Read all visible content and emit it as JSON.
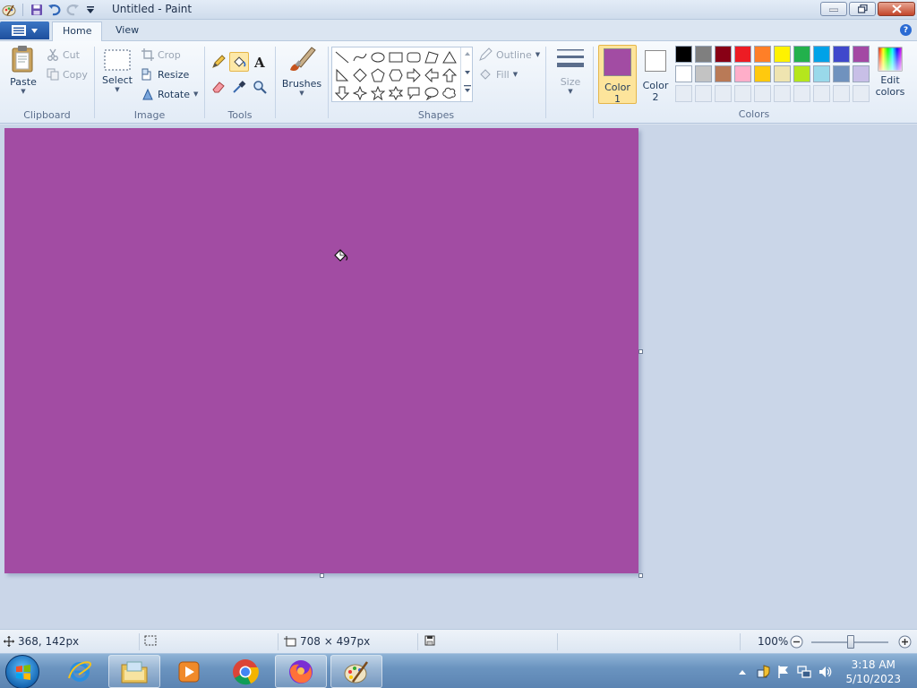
{
  "window": {
    "title": "Untitled - Paint"
  },
  "tabs": {
    "home": "Home",
    "view": "View"
  },
  "ribbon": {
    "clipboard": {
      "label": "Clipboard",
      "paste": "Paste",
      "cut": "Cut",
      "copy": "Copy"
    },
    "image": {
      "label": "Image",
      "select": "Select",
      "crop": "Crop",
      "resize": "Resize",
      "rotate": "Rotate"
    },
    "tools": {
      "label": "Tools",
      "selected": "fill"
    },
    "brushes": {
      "label": "Brushes"
    },
    "shapes": {
      "label": "Shapes",
      "outline": "Outline",
      "fill": "Fill"
    },
    "size": {
      "label": "Size"
    },
    "colors": {
      "label": "Colors",
      "color1_label_a": "Color",
      "color1_label_b": "1",
      "color2_label_a": "Color",
      "color2_label_b": "2",
      "color1": "#a24ca3",
      "color2": "#ffffff",
      "edit_a": "Edit",
      "edit_b": "colors",
      "palette_row1": [
        "#000000",
        "#7f7f7f",
        "#880015",
        "#ed1c24",
        "#ff7f27",
        "#fff200",
        "#22b14c",
        "#00a2e8",
        "#3f48cc",
        "#a349a4"
      ],
      "palette_row2": [
        "#ffffff",
        "#c3c3c3",
        "#b97a57",
        "#ffaec9",
        "#ffc90e",
        "#efe4b0",
        "#b5e61d",
        "#99d9ea",
        "#7092be",
        "#c8bfe7"
      ]
    }
  },
  "canvas": {
    "color": "#a24ca3"
  },
  "status": {
    "cursor_pos": "368, 142px",
    "canvas_size": "708 × 497px",
    "zoom": "100%"
  },
  "taskbar": {
    "time": "3:18 AM",
    "date": "5/10/2023",
    "apps": [
      "internet-explorer",
      "file-explorer",
      "media-player",
      "chrome",
      "firefox",
      "paint"
    ]
  }
}
